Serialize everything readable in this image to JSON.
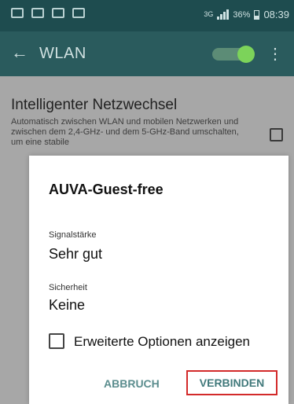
{
  "status_bar": {
    "network_type": "3G",
    "battery_percent": "36%",
    "time": "08:39"
  },
  "toolbar": {
    "back_glyph": "←",
    "title": "WLAN",
    "wifi_switch_on": true,
    "more_glyph": "⋮"
  },
  "settings": {
    "smart_switch_title": "Intelligenter Netzwechsel",
    "smart_switch_desc": "Automatisch zwischen WLAN und mobilen Netzwerken und zwischen dem 2,4-GHz- und dem 5-GHz-Band umschalten, um eine stabile"
  },
  "dialog": {
    "title": "AUVA-Guest-free",
    "signal_label": "Signalstärke",
    "signal_value": "Sehr gut",
    "security_label": "Sicherheit",
    "security_value": "Keine",
    "advanced_label": "Erweiterte Optionen anzeigen",
    "cancel_label": "ABBRUCH",
    "connect_label": "VERBINDEN"
  }
}
